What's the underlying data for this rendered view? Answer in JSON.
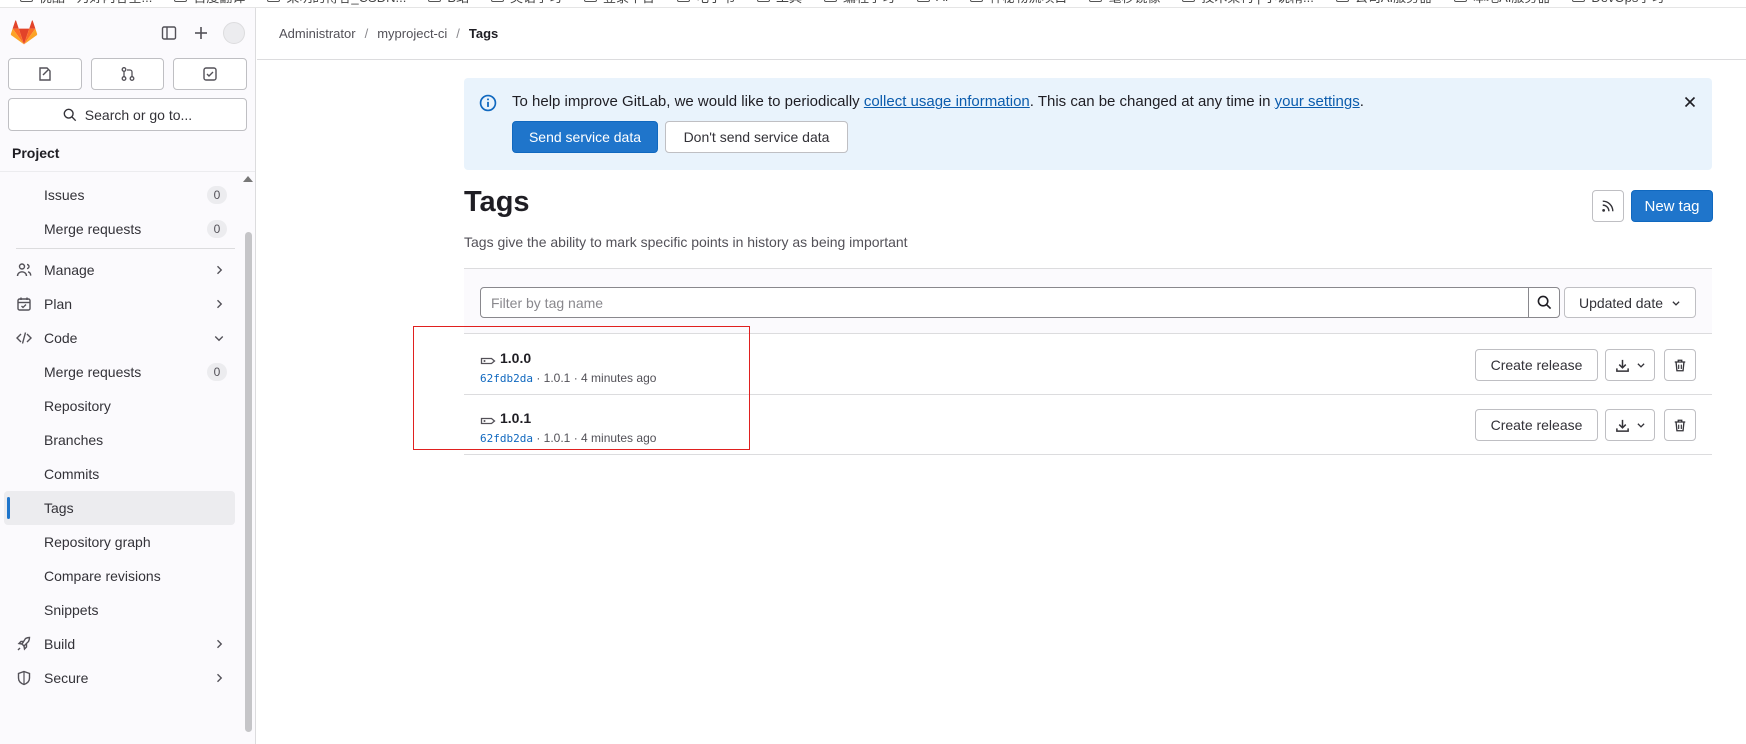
{
  "browser": {
    "bookmarks": [
      "优酷 - 为好内容全...",
      "百度翻译",
      "果明的博客_CSDN...",
      "B站",
      "英语学习",
      "登录平台",
      "电子书",
      "工具",
      "编程学习",
      "AI",
      "神秘物流项目",
      "毫秒镜像",
      "技术架构 | 小说精...",
      "公司AI服务器",
      "本地AI服务器",
      "DevOps学习"
    ]
  },
  "sidebar": {
    "counters": [
      "issues-counter",
      "merge-requests-counter",
      "todos-counter"
    ],
    "search_label": "Search or go to...",
    "section_title": "Project",
    "items": [
      {
        "label": "Issues",
        "badge": "0",
        "level": "sub"
      },
      {
        "label": "Merge requests",
        "badge": "0",
        "level": "sub"
      },
      {
        "label": "Manage",
        "icon": "users-icon",
        "chevron": "right",
        "level": "top"
      },
      {
        "label": "Plan",
        "icon": "calendar-icon",
        "chevron": "right",
        "level": "top"
      },
      {
        "label": "Code",
        "icon": "code-icon",
        "chevron": "down",
        "level": "top"
      },
      {
        "label": "Merge requests",
        "badge": "0",
        "level": "sub"
      },
      {
        "label": "Repository",
        "level": "sub"
      },
      {
        "label": "Branches",
        "level": "sub"
      },
      {
        "label": "Commits",
        "level": "sub"
      },
      {
        "label": "Tags",
        "level": "sub",
        "active": true
      },
      {
        "label": "Repository graph",
        "level": "sub"
      },
      {
        "label": "Compare revisions",
        "level": "sub"
      },
      {
        "label": "Snippets",
        "level": "sub"
      },
      {
        "label": "Build",
        "icon": "rocket-icon",
        "chevron": "right",
        "level": "top"
      },
      {
        "label": "Secure",
        "icon": "shield-icon",
        "chevron": "right",
        "level": "top"
      }
    ]
  },
  "breadcrumb": {
    "items": [
      "Administrator",
      "myproject-ci"
    ],
    "current": "Tags",
    "separator": "/"
  },
  "banner": {
    "text_before": "To help improve GitLab, we would like to periodically ",
    "link1": "collect usage information",
    "text_middle": ". This can be changed at any time in ",
    "link2": "your settings",
    "text_after": ".",
    "send_label": "Send service data",
    "dont_send_label": "Don't send service data"
  },
  "page": {
    "title": "Tags",
    "description": "Tags give the ability to mark specific points in history as being important",
    "new_tag_label": "New tag"
  },
  "filter": {
    "placeholder": "Filter by tag name",
    "sort_label": "Updated date"
  },
  "tags": [
    {
      "name": "1.0.0",
      "sha": "62fdb2da",
      "message": "1.0.1",
      "time": "4 minutes ago",
      "create_release_label": "Create release"
    },
    {
      "name": "1.0.1",
      "sha": "62fdb2da",
      "message": "1.0.1",
      "time": "4 minutes ago",
      "create_release_label": "Create release"
    }
  ],
  "colors": {
    "primary": "#1f75cb",
    "banner_bg": "#e9f3fc",
    "highlight": "#e0201f",
    "link": "#0b5cad"
  }
}
